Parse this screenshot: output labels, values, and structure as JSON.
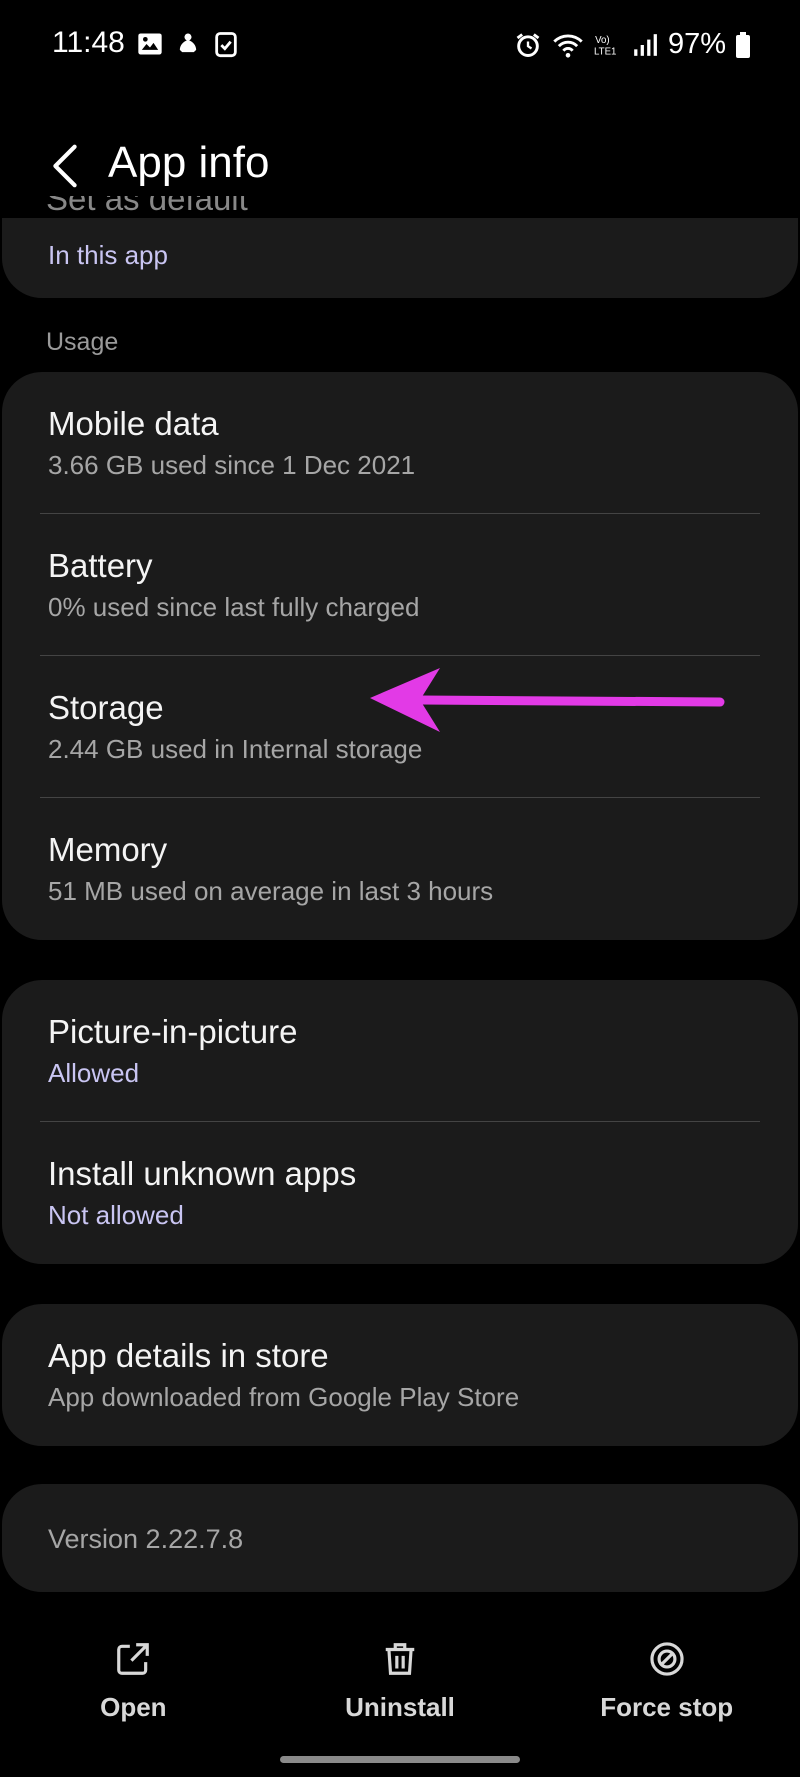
{
  "status_bar": {
    "time": "11:48",
    "battery": "97%",
    "network": "VoLTE1",
    "icons": [
      "gallery-icon",
      "notification-icon",
      "clipboard-icon",
      "alarm-icon",
      "wifi-icon",
      "signal-icon",
      "battery-icon"
    ]
  },
  "header": {
    "title": "App info",
    "back_icon": "back-icon"
  },
  "cards": {
    "default": {
      "title": "Set as default",
      "subtitle": "In this app"
    },
    "usage_label": "Usage",
    "usage": [
      {
        "title": "Mobile data",
        "subtitle": "3.66 GB used since 1 Dec 2021"
      },
      {
        "title": "Battery",
        "subtitle": "0% used since last fully charged"
      },
      {
        "title": "Storage",
        "subtitle": "2.44 GB used in Internal storage"
      },
      {
        "title": "Memory",
        "subtitle": "51 MB used on average in last 3 hours"
      }
    ],
    "permissions": [
      {
        "title": "Picture-in-picture",
        "subtitle": "Allowed"
      },
      {
        "title": "Install unknown apps",
        "subtitle": "Not allowed"
      }
    ],
    "store": {
      "title": "App details in store",
      "subtitle": "App downloaded from Google Play Store"
    },
    "version": "Version 2.22.7.8"
  },
  "actions": {
    "open": "Open",
    "uninstall": "Uninstall",
    "force_stop": "Force stop"
  },
  "colors": {
    "background": "#000000",
    "card": "#1b1b1b",
    "accent_subtitle": "#c9c5f2",
    "annotation_arrow": "#e23ae6"
  }
}
